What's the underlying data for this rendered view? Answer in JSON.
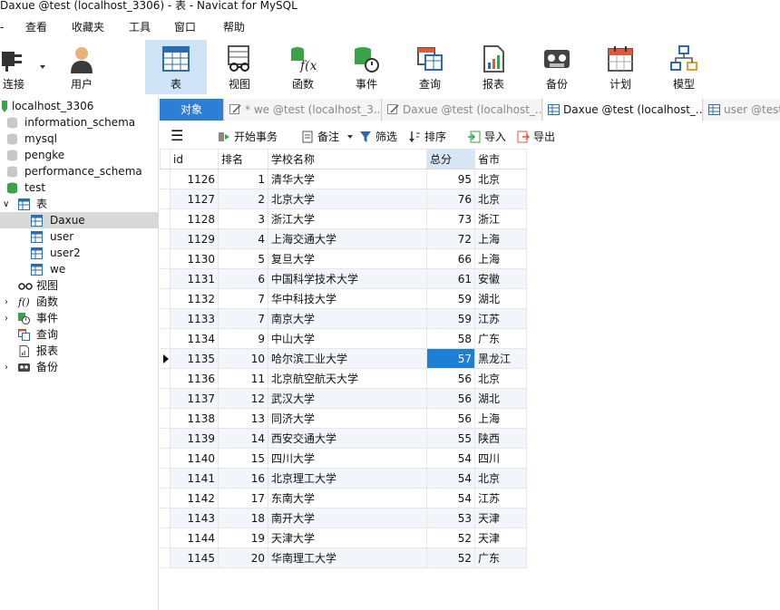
{
  "window": {
    "title": "Daxue @test (localhost_3306) - 表 - Navicat for MySQL"
  },
  "menu": {
    "items": [
      "查看",
      "收藏夹",
      "工具",
      "窗口",
      "帮助"
    ]
  },
  "toolbar": {
    "connect_label": "连接",
    "user_label": "用户",
    "buttons": [
      {
        "label": "表",
        "icon": "table-icon"
      },
      {
        "label": "视图",
        "icon": "view-icon"
      },
      {
        "label": "函数",
        "icon": "function-icon"
      },
      {
        "label": "事件",
        "icon": "event-icon"
      },
      {
        "label": "查询",
        "icon": "query-icon"
      },
      {
        "label": "报表",
        "icon": "report-icon"
      },
      {
        "label": "备份",
        "icon": "backup-icon"
      },
      {
        "label": "计划",
        "icon": "schedule-icon"
      },
      {
        "label": "模型",
        "icon": "model-icon"
      }
    ]
  },
  "sidebar": {
    "connection": "localhost_3306",
    "databases": [
      "information_schema",
      "mysql",
      "pengke",
      "performance_schema",
      "test"
    ],
    "tables_group": "表",
    "tables": [
      "Daxue",
      "user",
      "user2",
      "we"
    ],
    "groups": [
      "视图",
      "函数",
      "事件",
      "查询",
      "报表",
      "备份"
    ]
  },
  "tabs": {
    "objects_label": "对象",
    "items": [
      "* we @test (localhost_3...",
      "Daxue @test (localhost_...",
      "Daxue @test (localhost_...",
      "user @test"
    ]
  },
  "actions": {
    "menu_icon": "hamburger-icon",
    "begin_transaction": "开始事务",
    "note": "备注",
    "filter": "筛选",
    "sort": "排序",
    "import": "导入",
    "export": "导出"
  },
  "grid": {
    "columns": [
      "id",
      "排名",
      "学校名称",
      "总分",
      "省市"
    ],
    "rows": [
      [
        "1126",
        "1",
        "清华大学",
        "95",
        "北京"
      ],
      [
        "1127",
        "2",
        "北京大学",
        "76",
        "北京"
      ],
      [
        "1128",
        "3",
        "浙江大学",
        "73",
        "浙江"
      ],
      [
        "1129",
        "4",
        "上海交通大学",
        "72",
        "上海"
      ],
      [
        "1130",
        "5",
        "复旦大学",
        "66",
        "上海"
      ],
      [
        "1131",
        "6",
        "中国科学技术大学",
        "61",
        "安徽"
      ],
      [
        "1132",
        "7",
        "华中科技大学",
        "59",
        "湖北"
      ],
      [
        "1133",
        "7",
        "南京大学",
        "59",
        "江苏"
      ],
      [
        "1134",
        "9",
        "中山大学",
        "58",
        "广东"
      ],
      [
        "1135",
        "10",
        "哈尔滨工业大学",
        "57",
        "黑龙江"
      ],
      [
        "1136",
        "11",
        "北京航空航天大学",
        "56",
        "北京"
      ],
      [
        "1137",
        "12",
        "武汉大学",
        "56",
        "湖北"
      ],
      [
        "1138",
        "13",
        "同济大学",
        "56",
        "上海"
      ],
      [
        "1139",
        "14",
        "西安交通大学",
        "55",
        "陕西"
      ],
      [
        "1140",
        "15",
        "四川大学",
        "54",
        "四川"
      ],
      [
        "1141",
        "16",
        "北京理工大学",
        "54",
        "北京"
      ],
      [
        "1142",
        "17",
        "东南大学",
        "54",
        "江苏"
      ],
      [
        "1143",
        "18",
        "南开大学",
        "53",
        "天津"
      ],
      [
        "1144",
        "19",
        "天津大学",
        "52",
        "天津"
      ],
      [
        "1145",
        "20",
        "华南理工大学",
        "52",
        "广东"
      ]
    ]
  }
}
